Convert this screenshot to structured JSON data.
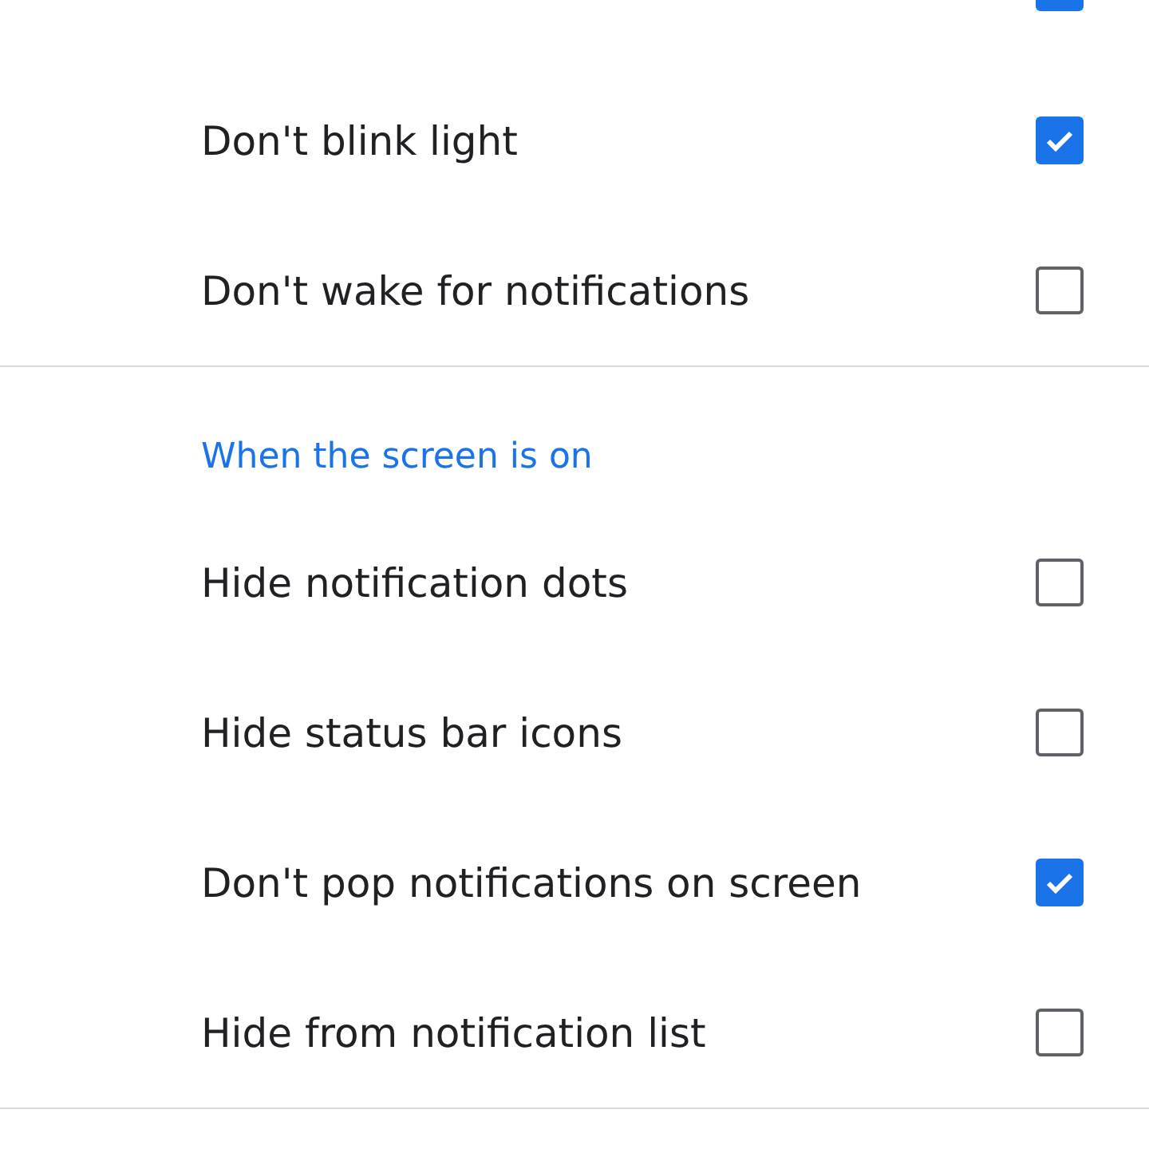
{
  "top_cut_row": {
    "checked": true
  },
  "sections": [
    {
      "items": [
        {
          "label": "Don't blink light",
          "checked": true
        },
        {
          "label": "Don't wake for notifications",
          "checked": false
        }
      ]
    },
    {
      "header": "When the screen is on",
      "items": [
        {
          "label": "Hide notification dots",
          "checked": false
        },
        {
          "label": "Hide status bar icons",
          "checked": false
        },
        {
          "label": "Don't pop notifications on screen",
          "checked": true
        },
        {
          "label": "Hide from notification list",
          "checked": false
        }
      ]
    }
  ]
}
